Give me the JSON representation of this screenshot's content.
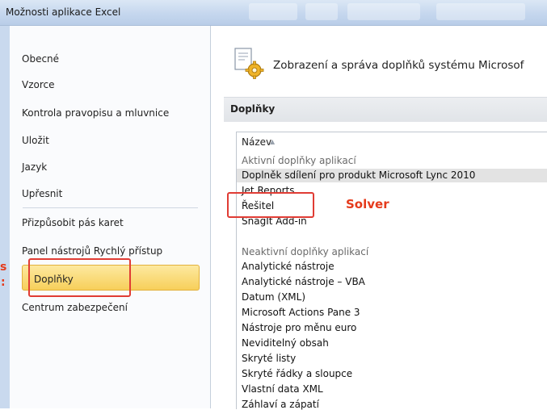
{
  "window": {
    "title": "Možnosti aplikace Excel"
  },
  "nav": {
    "items": [
      {
        "label": "Obecné"
      },
      {
        "label": "Vzorce"
      },
      {
        "label": "Kontrola pravopisu a mluvnice"
      },
      {
        "label": "Uložit"
      },
      {
        "label": "Jazyk"
      },
      {
        "label": "Upřesnit"
      },
      {
        "label": "Přizpůsobit pás karet"
      },
      {
        "label": "Panel nástrojů Rychlý přístup"
      },
      {
        "label": "Doplňky",
        "selected": true
      },
      {
        "label": "Centrum zabezpečení"
      }
    ]
  },
  "content": {
    "header_title": "Zobrazení a správa doplňků systému Microsof",
    "section_title": "Doplňky",
    "column_header": "Název",
    "active_group": {
      "label": "Aktivní doplňky aplikací",
      "items": [
        "Doplněk sdílení pro produkt Microsoft Lync 2010",
        "Jet Reports",
        "Řešitel",
        "SnagIt Add-in"
      ]
    },
    "inactive_group": {
      "label": "Neaktivní doplňky aplikací",
      "items": [
        "Analytické nástroje",
        "Analytické nástroje – VBA",
        "Datum (XML)",
        "Microsoft Actions Pane 3",
        "Nástroje pro měnu euro",
        "Neviditelný obsah",
        "Skryté listy",
        "Skryté řádky a sloupce",
        "Vlastní data XML",
        "Záhlaví a zápatí"
      ]
    }
  },
  "annotations": {
    "solver_label": "Solver",
    "left_fragment_1": "s",
    "left_fragment_2": ":",
    "color": "#e53a1b"
  },
  "colors": {
    "selected_nav": "#f7cf5a",
    "title_bar": "#c5d7ee",
    "annotation_red": "#e03c34"
  }
}
